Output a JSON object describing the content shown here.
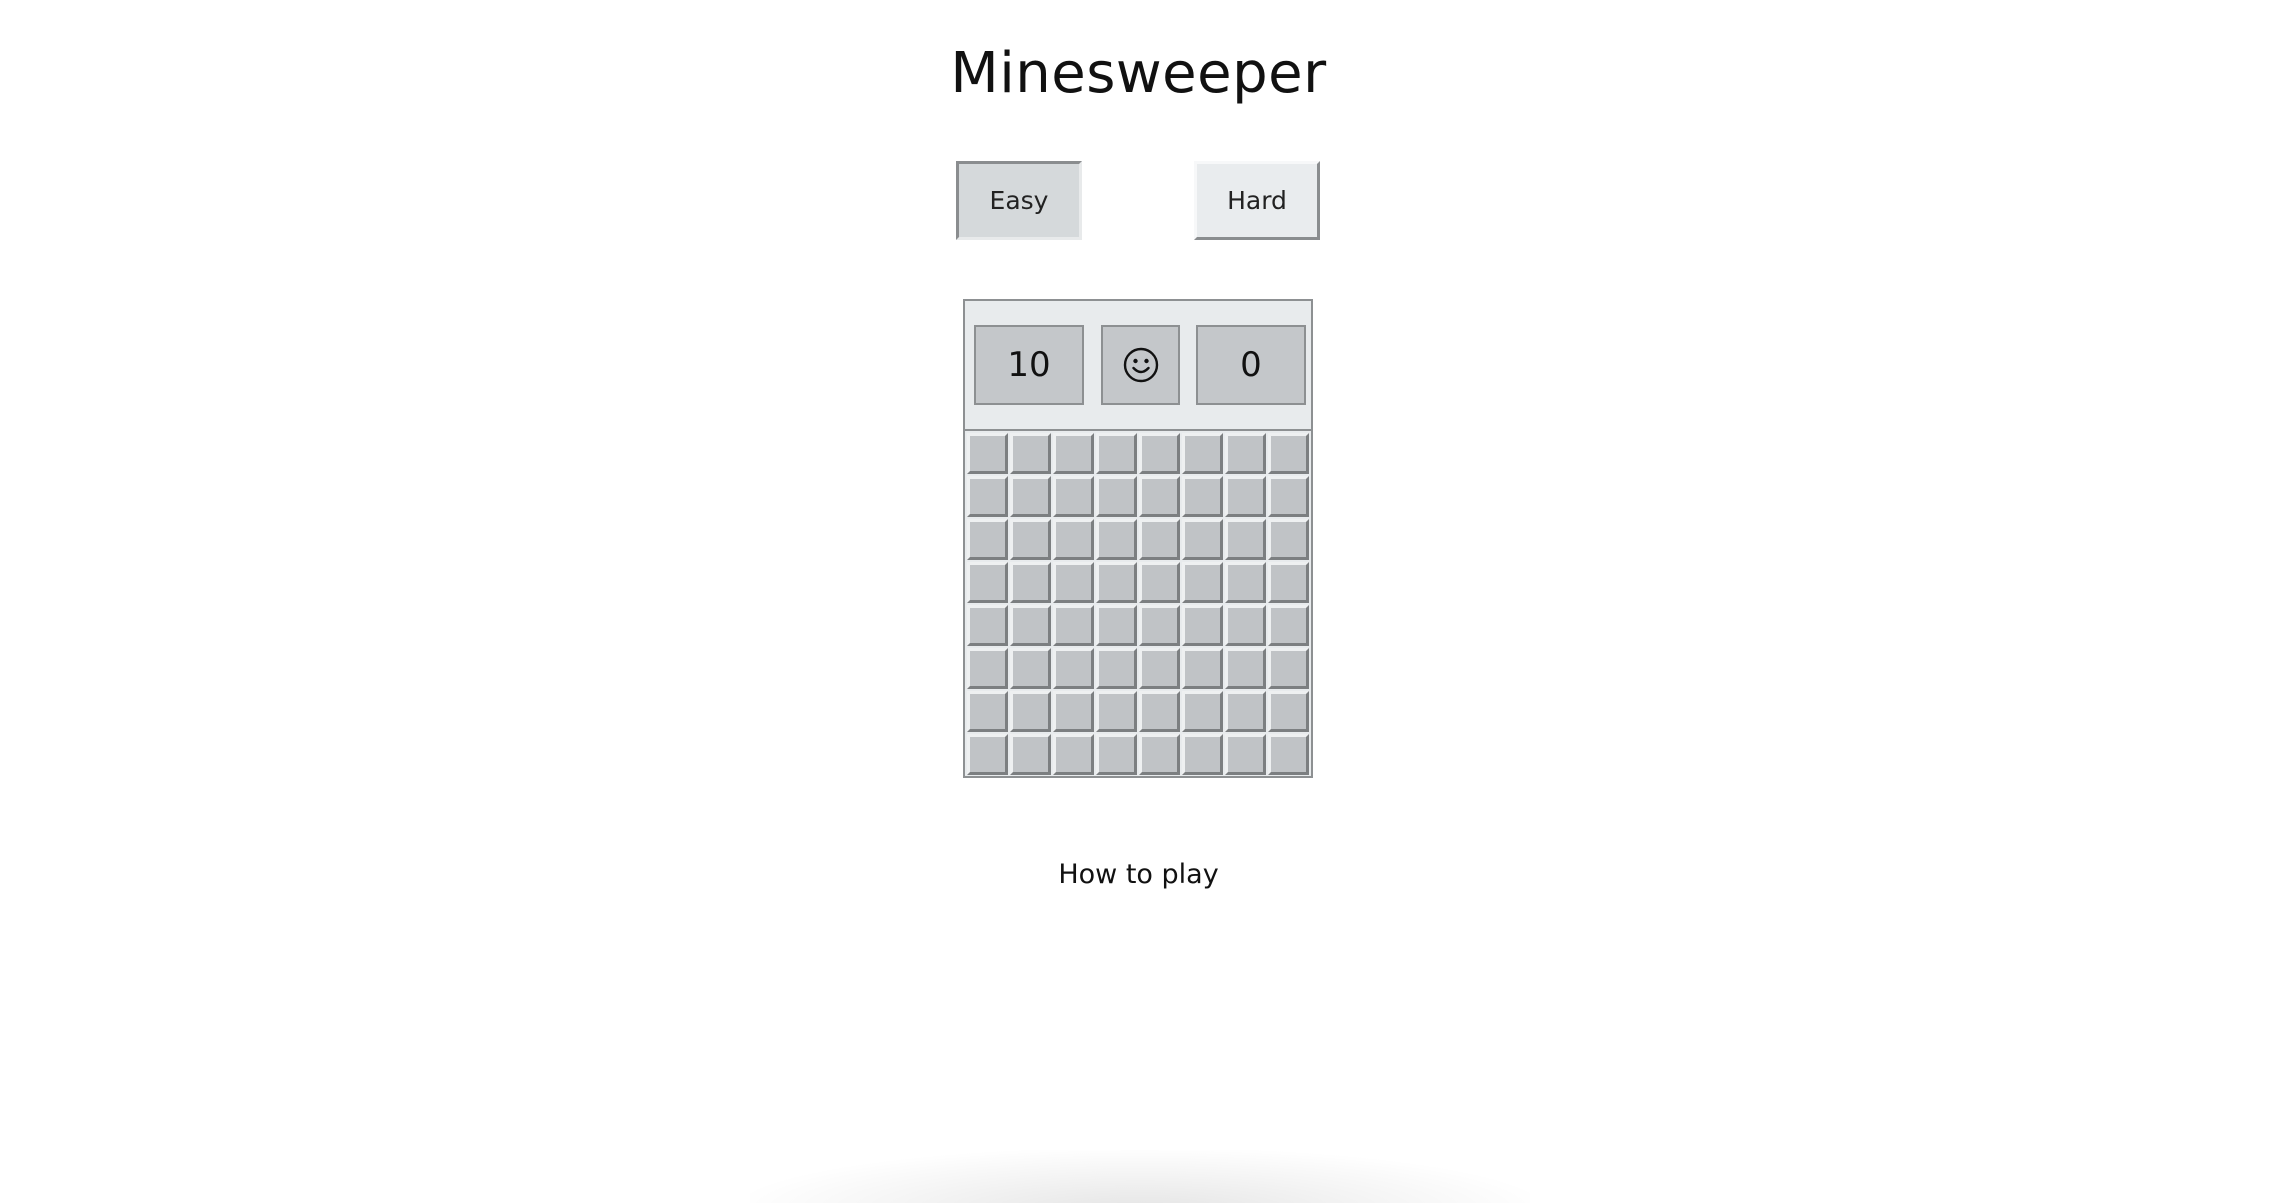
{
  "page": {
    "title": "Minesweeper"
  },
  "modes": {
    "easy_label": "Easy",
    "hard_label": "Hard",
    "selected": "Easy"
  },
  "game": {
    "mines_remaining": "10",
    "timer": "0",
    "face_icon": "smiley-face-icon",
    "rows": 8,
    "cols": 8,
    "cell_state": "covered"
  },
  "footer": {
    "how_to_play_label": "How to play"
  },
  "colors": {
    "cell": "#c0c3c6",
    "panel": "#e8ebed",
    "selected_mode": "#d5d9db"
  }
}
